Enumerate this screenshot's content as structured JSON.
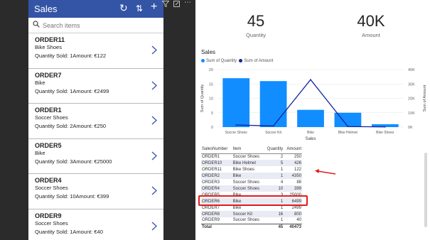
{
  "app": {
    "title": "Sales",
    "search_placeholder": "Search items",
    "items": [
      {
        "title": "ORDER11",
        "product": "Bike Shoes",
        "meta": "Quantity Sold: 1Amount: €122"
      },
      {
        "title": "ORDER7",
        "product": "Bike",
        "meta": "Quantity Sold: 1Amount: €2499"
      },
      {
        "title": "ORDER1",
        "product": "Soccer Shoes",
        "meta": "Quantity Sold: 2Amount: €250"
      },
      {
        "title": "ORDER5",
        "product": "Bike",
        "meta": "Quantity Sold: 3Amount: €25000"
      },
      {
        "title": "ORDER4",
        "product": "Soccer Shoes",
        "meta": "Quantity Sold: 10Amount: €399"
      },
      {
        "title": "ORDER9",
        "product": "Soccer Shoes",
        "meta": "Quantity Sold: 1Amount: €40"
      }
    ]
  },
  "cards": {
    "quantity": {
      "value": "45",
      "label": "Quantity"
    },
    "amount": {
      "value": "40K",
      "label": "Amount"
    }
  },
  "colors": {
    "app_header": "#3454a6",
    "bar": "#118dff",
    "line": "#12239e",
    "highlight": "#e21c1c"
  },
  "chart_data": {
    "type": "bar",
    "title": "Sales",
    "legend": [
      "Sum of Quantity",
      "Sum of Amount"
    ],
    "legend_placement": "top-left",
    "xlabel": "Sales",
    "ylabel": "Sum of Quantity",
    "y2label": "Sum of Amount",
    "categories": [
      "Soccer Shoes",
      "Soccer Kit",
      "Bike",
      "Bike Helmet",
      "Bike Shoes"
    ],
    "series": [
      {
        "name": "Sum of Quantity",
        "kind": "bar",
        "axis": "left",
        "values": [
          17,
          16,
          6,
          5,
          1
        ]
      },
      {
        "name": "Sum of Amount",
        "kind": "line",
        "axis": "right",
        "values": [
          1500,
          800,
          33000,
          426,
          122
        ]
      }
    ],
    "ylim": [
      0,
      20
    ],
    "y2lim": [
      0,
      40000
    ],
    "yticks": [
      "0",
      "5",
      "10",
      "15",
      "20"
    ],
    "y2ticks": [
      "0K",
      "10K",
      "20K",
      "30K",
      "40K"
    ],
    "grid": true
  },
  "table": {
    "headers": [
      "SalesNumber",
      "Item",
      "Quantity",
      "Amount"
    ],
    "rows": [
      [
        "ORDER1",
        "Soccer Shoes",
        "2",
        "250"
      ],
      [
        "ORDER10",
        "Bike Helmet",
        "5",
        "426"
      ],
      [
        "ORDER11",
        "Bike Shoes",
        "1",
        "122"
      ],
      [
        "ORDER2",
        "Bike",
        "1",
        "4350"
      ],
      [
        "ORDER3",
        "Soccer Shoes",
        "4",
        "88"
      ],
      [
        "ORDER4",
        "Soccer Shoes",
        "10",
        "399"
      ],
      [
        "ORDER5",
        "Bike",
        "3",
        "25000"
      ],
      [
        "ORDER6",
        "Bike",
        "1",
        "6499"
      ],
      [
        "ORDER7",
        "Bike",
        "1",
        "2499"
      ],
      [
        "ORDER8",
        "Soccer Kit",
        "16",
        "800"
      ],
      [
        "ORDER9",
        "Soccer Shoes",
        "1",
        "40"
      ]
    ],
    "total": [
      "Total",
      "",
      "45",
      "40473"
    ]
  }
}
